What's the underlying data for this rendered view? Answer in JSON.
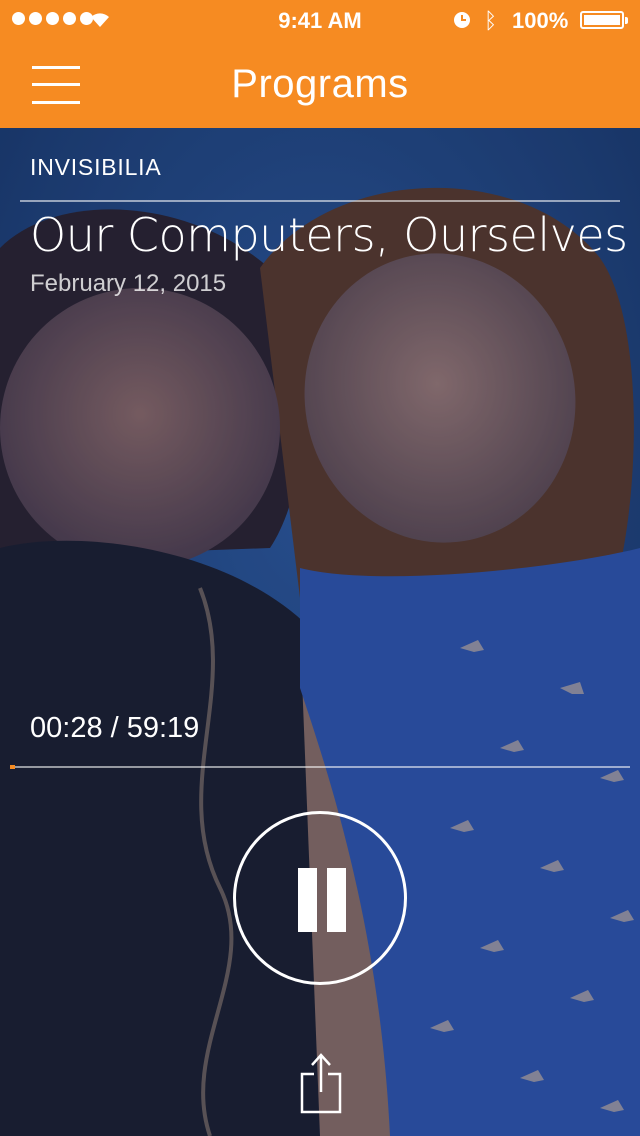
{
  "status_bar": {
    "time": "9:41 AM",
    "battery_percent": "100%",
    "signal_bars": 5,
    "icons": [
      "signal-dots-icon",
      "wifi-icon",
      "alarm-icon",
      "bluetooth-icon",
      "battery-icon"
    ]
  },
  "nav": {
    "title": "Programs",
    "menu_icon": "hamburger-menu-icon"
  },
  "episode": {
    "program": "INVISIBILIA",
    "title": "Our Computers, Ourselves",
    "date": "February 12, 2015"
  },
  "player": {
    "timecode": "00:28 / 59:19",
    "progress_fraction": 0.008,
    "state_icon": "pause-icon",
    "share_icon": "share-icon"
  },
  "colors": {
    "accent": "#F68B22",
    "text": "#FFFFFF"
  }
}
